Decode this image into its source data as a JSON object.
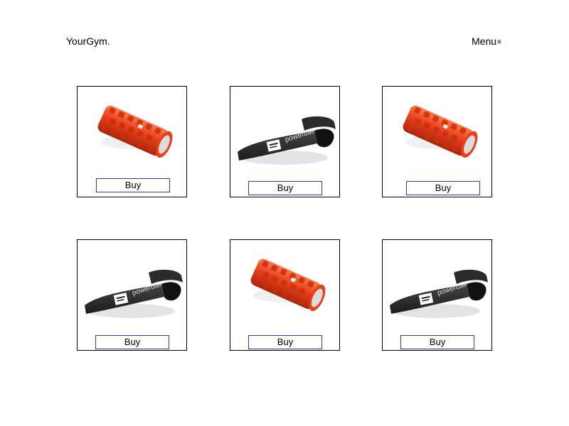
{
  "header": {
    "brand": "YourGym.",
    "menu_label": "Menu",
    "menu_icon_glyph": "≡",
    "menu_icon": "hamburger-icon"
  },
  "colors": {
    "roller": "#e8401a",
    "roller_dark": "#b52a0c",
    "band": "#2b2b2b",
    "button_border": "#3333cc"
  },
  "products": [
    {
      "type": "foam-roller",
      "buy_label": "Buy"
    },
    {
      "type": "resistance-band",
      "buy_label": "Buy",
      "band_text": "powerball"
    },
    {
      "type": "foam-roller",
      "buy_label": "Buy"
    },
    {
      "type": "resistance-band",
      "buy_label": "Buy",
      "band_text": "powerball"
    },
    {
      "type": "foam-roller",
      "buy_label": "Buy"
    },
    {
      "type": "resistance-band",
      "buy_label": "Buy",
      "band_text": "powerball"
    }
  ]
}
